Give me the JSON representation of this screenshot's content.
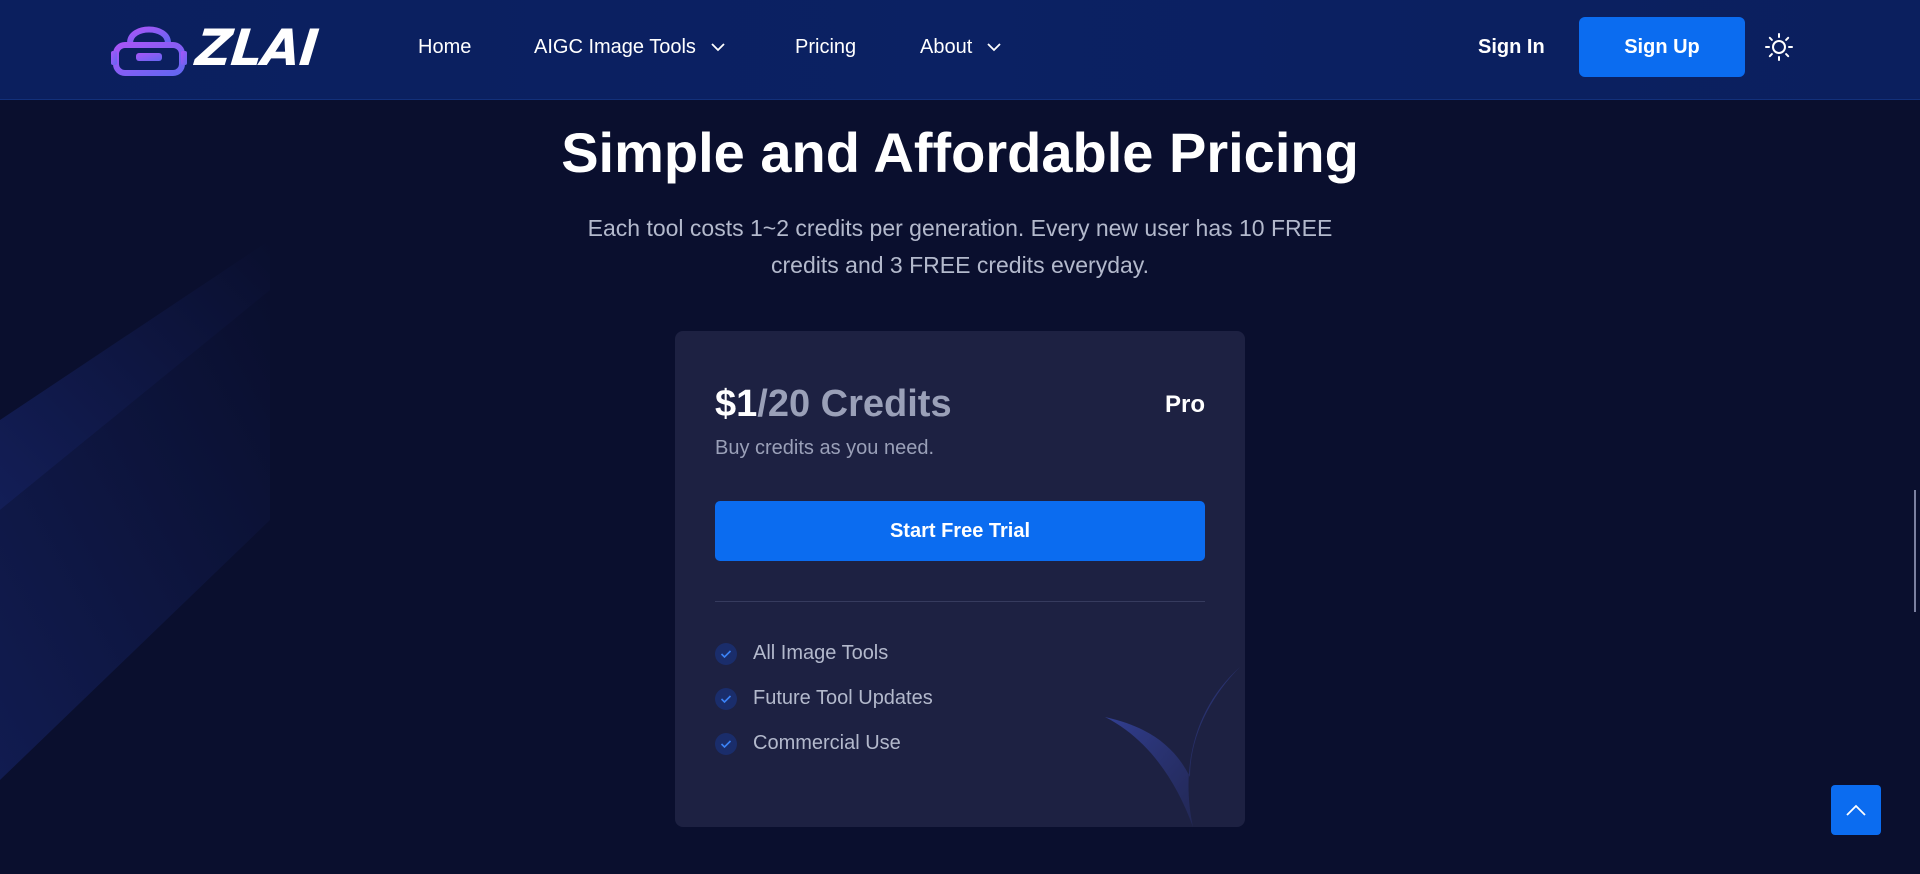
{
  "brand": {
    "logo_text": "ZLAI",
    "icon": "vr-headset-icon"
  },
  "nav": {
    "items": [
      {
        "label": "Home",
        "has_dropdown": false
      },
      {
        "label": "AIGC Image Tools",
        "has_dropdown": true
      },
      {
        "label": "Pricing",
        "has_dropdown": false
      },
      {
        "label": "About",
        "has_dropdown": true
      }
    ],
    "sign_in": "Sign In",
    "sign_up": "Sign Up",
    "theme_icon": "sun-icon"
  },
  "hero": {
    "title": "Simple and Affordable Pricing",
    "subtitle": "Each tool costs 1~2 credits per generation. Every new user has 10 FREE credits and 3 FREE credits everyday."
  },
  "plan": {
    "price": "$1",
    "unit": "/20 Credits",
    "name": "Pro",
    "description": "Buy credits as you need.",
    "cta": "Start Free Trial",
    "features": [
      "All Image Tools",
      "Future Tool Updates",
      "Commercial Use"
    ]
  },
  "colors": {
    "background": "#0a0f2e",
    "navbar": "#0b2163",
    "accent": "#0b6cf0",
    "card": "#1d2142",
    "muted_text": "#9aa0b8"
  },
  "scroll_top_icon": "chevron-up-icon"
}
